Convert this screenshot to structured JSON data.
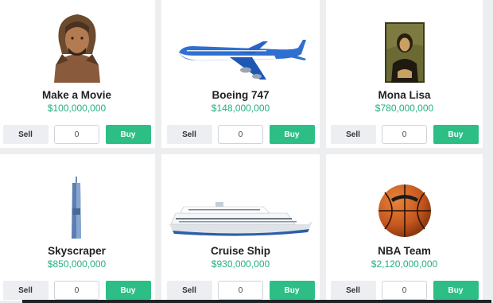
{
  "controls": {
    "sell_label": "Sell",
    "buy_label": "Buy"
  },
  "items": [
    {
      "name": "Make a Movie",
      "price": "$100,000,000",
      "quantity": "0",
      "icon": "actor-portrait-icon"
    },
    {
      "name": "Boeing 747",
      "price": "$148,000,000",
      "quantity": "0",
      "icon": "airplane-icon"
    },
    {
      "name": "Mona Lisa",
      "price": "$780,000,000",
      "quantity": "0",
      "icon": "painting-icon"
    },
    {
      "name": "Skyscraper",
      "price": "$850,000,000",
      "quantity": "0",
      "icon": "skyscraper-icon"
    },
    {
      "name": "Cruise Ship",
      "price": "$930,000,000",
      "quantity": "0",
      "icon": "cruise-ship-icon"
    },
    {
      "name": "NBA Team",
      "price": "$2,120,000,000",
      "quantity": "0",
      "icon": "basketball-icon"
    }
  ],
  "colors": {
    "price": "#23b07d",
    "buy": "#2dbe86",
    "sell": "#eceef1"
  }
}
